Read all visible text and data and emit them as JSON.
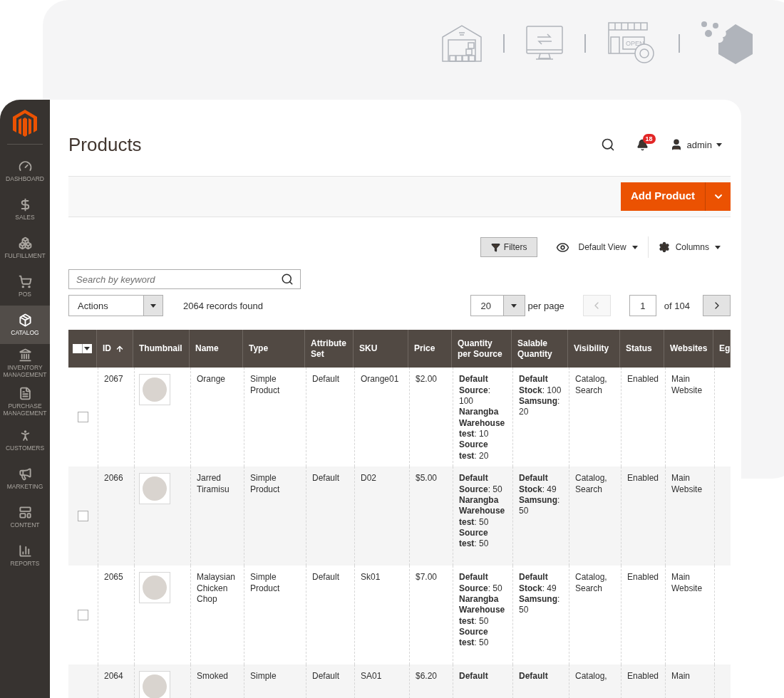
{
  "banner": {
    "shop_sign": "OPEN"
  },
  "sidebar": {
    "items": [
      {
        "label": "DASHBOARD",
        "selected": false
      },
      {
        "label": "SALES",
        "selected": false
      },
      {
        "label": "FULFILLMENT",
        "selected": false
      },
      {
        "label": "POS",
        "selected": false
      },
      {
        "label": "CATALOG",
        "selected": true
      },
      {
        "label": "INVENTORY MANAGEMENT",
        "selected": false
      },
      {
        "label": "PURCHASE MANAGEMENT",
        "selected": false
      },
      {
        "label": "CUSTOMERS",
        "selected": false
      },
      {
        "label": "MARKETING",
        "selected": false
      },
      {
        "label": "CONTENT",
        "selected": false
      },
      {
        "label": "REPORTS",
        "selected": false
      }
    ]
  },
  "header": {
    "title": "Products",
    "notifications": "18",
    "user": "admin"
  },
  "toolbar": {
    "add_button": "Add Product"
  },
  "grid_controls": {
    "filters": "Filters",
    "view": "Default View",
    "columns": "Columns",
    "search_placeholder": "Search by keyword",
    "actions": "Actions",
    "records": "2064 records found",
    "per_page_value": "20",
    "per_page_label": "per page",
    "page": "1",
    "page_total": "of 104",
    "prev_disabled": true,
    "next_disabled": false
  },
  "table": {
    "columns": [
      {
        "label": "ID",
        "sorted": true
      },
      {
        "label": "Thumbnail",
        "sorted": false
      },
      {
        "label": "Name",
        "sorted": false
      },
      {
        "label": "Type",
        "sorted": false
      },
      {
        "label": "Attribute Set",
        "sorted": false
      },
      {
        "label": "SKU",
        "sorted": false
      },
      {
        "label": "Price",
        "sorted": false
      },
      {
        "label": "Quantity per Source",
        "sorted": false
      },
      {
        "label": "Salable Quantity",
        "sorted": false
      },
      {
        "label": "Visibility",
        "sorted": false
      },
      {
        "label": "Status",
        "sorted": false
      },
      {
        "label": "Websites",
        "sorted": false
      },
      {
        "label": "Eg"
      }
    ],
    "rows": [
      {
        "checked": false,
        "id": "2067",
        "name": "Orange",
        "type": "Simple Product",
        "attribute_set": "Default",
        "sku": "Orange01",
        "price": "$2.00",
        "qty": [
          "**Default Source**: 100",
          "**Narangba Warehouse test**: 10",
          "**Source test**: 20"
        ],
        "salable": [
          "**Default Stock**: 100",
          "**Samsung**: 20"
        ],
        "visibility": "Catalog, Search",
        "status": "Enabled",
        "websites": "Main Website"
      },
      {
        "checked": false,
        "id": "2066",
        "name": "Jarred Tiramisu",
        "type": "Simple Product",
        "attribute_set": "Default",
        "sku": "D02",
        "price": "$5.00",
        "qty": [
          "**Default Source**: 50",
          "**Narangba Warehouse test**: 50",
          "**Source test**: 50"
        ],
        "salable": [
          "**Default Stock**: 49",
          "**Samsung**: 50"
        ],
        "visibility": "Catalog, Search",
        "status": "Enabled",
        "websites": "Main Website"
      },
      {
        "checked": false,
        "id": "2065",
        "name": "Malaysian Chicken Chop",
        "type": "Simple Product",
        "attribute_set": "Default",
        "sku": "Sk01",
        "price": "$7.00",
        "qty": [
          "**Default Source**: 50",
          "**Narangba Warehouse test**: 50",
          "**Source test**: 50"
        ],
        "salable": [
          "**Default Stock**: 49",
          "**Samsung**: 50"
        ],
        "visibility": "Catalog, Search",
        "status": "Enabled",
        "websites": "Main Website"
      },
      {
        "id": "2064",
        "name": "Smoked",
        "type": "Simple",
        "attribute_set": "Default",
        "sku": "SA01",
        "price": "$6.20",
        "qty": [
          "**Default**"
        ],
        "salable": [
          "**Default**"
        ],
        "visibility": "Catalog,",
        "status": "Enabled",
        "websites": "Main"
      }
    ]
  }
}
